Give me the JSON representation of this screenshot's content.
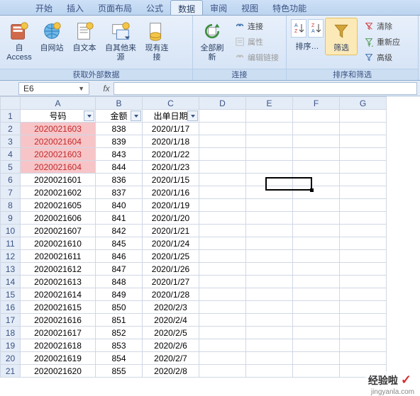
{
  "tabs": {
    "start": "开始",
    "insert": "插入",
    "layout": "页面布局",
    "formula": "公式",
    "data": "数据",
    "review": "审阅",
    "view": "视图",
    "special": "特色功能"
  },
  "ribbon": {
    "external": {
      "access": "自 Access",
      "web": "自网站",
      "text": "自文本",
      "other": "自其他来源",
      "existing": "现有连接",
      "group": "获取外部数据"
    },
    "connections": {
      "refresh": "全部刷新",
      "conn": "连接",
      "prop": "属性",
      "edit": "编辑链接",
      "group": "连接"
    },
    "sortfilter": {
      "sort": "排序…",
      "filter": "筛选",
      "clear": "清除",
      "reapply": "重新应",
      "advanced": "高级",
      "group": "排序和筛选"
    }
  },
  "formula_bar": {
    "name": "E6",
    "fx": "fx"
  },
  "columns": [
    "A",
    "B",
    "C",
    "D",
    "E",
    "F",
    "G"
  ],
  "headers": {
    "number": "号码",
    "amount": "金额",
    "date": "出单日期"
  },
  "rows": [
    {
      "n": 1
    },
    {
      "n": 2,
      "num": "2020021603",
      "amt": "838",
      "date": "2020/1/17",
      "hl": true
    },
    {
      "n": 3,
      "num": "2020021604",
      "amt": "839",
      "date": "2020/1/18",
      "hl": true
    },
    {
      "n": 4,
      "num": "2020021603",
      "amt": "843",
      "date": "2020/1/22",
      "hl": true
    },
    {
      "n": 5,
      "num": "2020021604",
      "amt": "844",
      "date": "2020/1/23",
      "hl": true
    },
    {
      "n": 6,
      "num": "2020021601",
      "amt": "836",
      "date": "2020/1/15"
    },
    {
      "n": 7,
      "num": "2020021602",
      "amt": "837",
      "date": "2020/1/16"
    },
    {
      "n": 8,
      "num": "2020021605",
      "amt": "840",
      "date": "2020/1/19"
    },
    {
      "n": 9,
      "num": "2020021606",
      "amt": "841",
      "date": "2020/1/20"
    },
    {
      "n": 10,
      "num": "2020021607",
      "amt": "842",
      "date": "2020/1/21"
    },
    {
      "n": 11,
      "num": "2020021610",
      "amt": "845",
      "date": "2020/1/24"
    },
    {
      "n": 12,
      "num": "2020021611",
      "amt": "846",
      "date": "2020/1/25"
    },
    {
      "n": 13,
      "num": "2020021612",
      "amt": "847",
      "date": "2020/1/26"
    },
    {
      "n": 14,
      "num": "2020021613",
      "amt": "848",
      "date": "2020/1/27"
    },
    {
      "n": 15,
      "num": "2020021614",
      "amt": "849",
      "date": "2020/1/28"
    },
    {
      "n": 16,
      "num": "2020021615",
      "amt": "850",
      "date": "2020/2/3"
    },
    {
      "n": 17,
      "num": "2020021616",
      "amt": "851",
      "date": "2020/2/4"
    },
    {
      "n": 18,
      "num": "2020021617",
      "amt": "852",
      "date": "2020/2/5"
    },
    {
      "n": 19,
      "num": "2020021618",
      "amt": "853",
      "date": "2020/2/6"
    },
    {
      "n": 20,
      "num": "2020021619",
      "amt": "854",
      "date": "2020/2/7"
    },
    {
      "n": 21,
      "num": "2020021620",
      "amt": "855",
      "date": "2020/2/8"
    }
  ],
  "selection": {
    "cell": "E6"
  },
  "watermark": {
    "text": "经验啦",
    "site": "jingyanla.com"
  }
}
